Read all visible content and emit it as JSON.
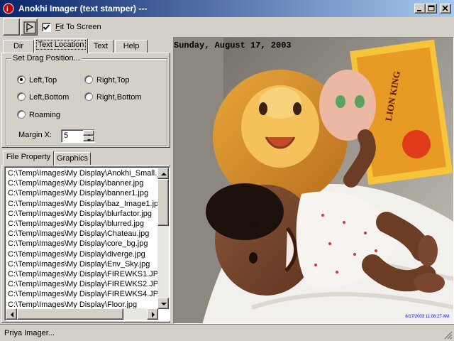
{
  "window": {
    "title": "Anokhi Imager (text stamper) ---",
    "minimize_label": "minimize",
    "maximize_label": "maximize",
    "close_label": "close"
  },
  "toolbar": {
    "fit_label_ul": "F",
    "fit_label_rest": "it To Screen",
    "fit_checked": true
  },
  "tabs": [
    {
      "label": "Dir"
    },
    {
      "label": "Text Location"
    },
    {
      "label": "Text"
    },
    {
      "label": "Help"
    }
  ],
  "drag_group": {
    "title": "Set Drag Position...",
    "options": [
      {
        "label": "Left,Top",
        "selected": true
      },
      {
        "label": "Right,Top",
        "selected": false
      },
      {
        "label": "Left,Bottom",
        "selected": false
      },
      {
        "label": "Right,Bottom",
        "selected": false
      },
      {
        "label": "Roaming",
        "selected": false
      }
    ],
    "margin_label": "Margin X:",
    "margin_value": "5"
  },
  "lower_tabs": [
    {
      "label": "File Property"
    },
    {
      "label": "Graphics"
    }
  ],
  "files": [
    "C:\\Temp\\Images\\My Display\\Anokhi_Small.j",
    "C:\\Temp\\Images\\My Display\\banner.jpg",
    "C:\\Temp\\Images\\My Display\\banner1.jpg",
    "C:\\Temp\\Images\\My Display\\baz_Image1.jp",
    "C:\\Temp\\Images\\My Display\\blurfactor.jpg",
    "C:\\Temp\\Images\\My Display\\blurred.jpg",
    "C:\\Temp\\Images\\My Display\\Chateau.jpg",
    "C:\\Temp\\Images\\My Display\\core_bg.jpg",
    "C:\\Temp\\Images\\My Display\\diverge.jpg",
    "C:\\Temp\\Images\\My Display\\Env_Sky.jpg",
    "C:\\Temp\\Images\\My Display\\FIREWKS1.JP",
    "C:\\Temp\\Images\\My Display\\FIREWKS2.JP",
    "C:\\Temp\\Images\\My Display\\FIREWKS4.JP",
    "C:\\Temp\\Images\\My Display\\Floor.jpg"
  ],
  "image": {
    "date_stamp": "Sunday, August 17, 2003",
    "corner_stamp": "8/17/2003 11:08:27 AM",
    "toy_box_text": "LION KING"
  },
  "status": {
    "text": "Priya Imager..."
  },
  "colors": {
    "titlebar_start": "#0a246a",
    "titlebar_end": "#a6caf0",
    "face": "#d4d0c8",
    "stamp_blue": "#0000cc"
  }
}
